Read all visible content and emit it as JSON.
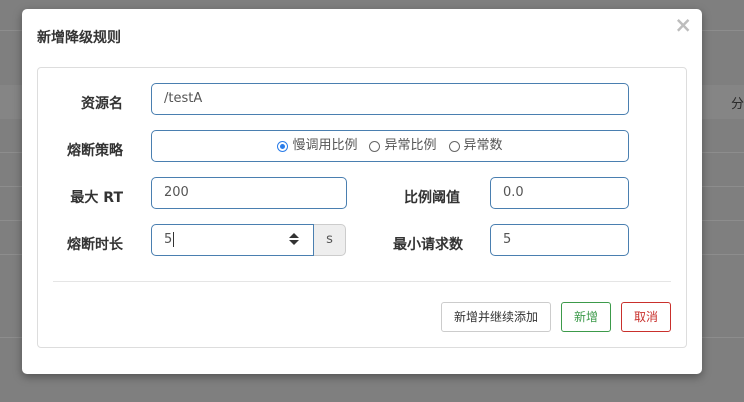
{
  "background": {
    "right_text": "分"
  },
  "dialog": {
    "title": "新增降级规则",
    "close_symbol": "×"
  },
  "form": {
    "resource_label": "资源名",
    "resource_value": "/testA",
    "strategy_label": "熔断策略",
    "strategy_options": [
      {
        "label": "慢调用比例",
        "checked": true
      },
      {
        "label": "异常比例",
        "checked": false
      },
      {
        "label": "异常数",
        "checked": false
      }
    ],
    "max_rt_label": "最大 RT",
    "max_rt_value": "200",
    "ratio_threshold_label": "比例阈值",
    "ratio_threshold_value": "0.0",
    "break_duration_label": "熔断时长",
    "break_duration_value": "5",
    "break_duration_unit": "s",
    "min_request_label": "最小请求数",
    "min_request_value": "5"
  },
  "buttons": {
    "add_continue": "新增并继续添加",
    "add": "新增",
    "cancel": "取消"
  },
  "colors": {
    "radio_checked": "#2b7de9",
    "input_border": "#4a7fb0",
    "success": "#3c9a4a",
    "danger": "#c9302c"
  }
}
